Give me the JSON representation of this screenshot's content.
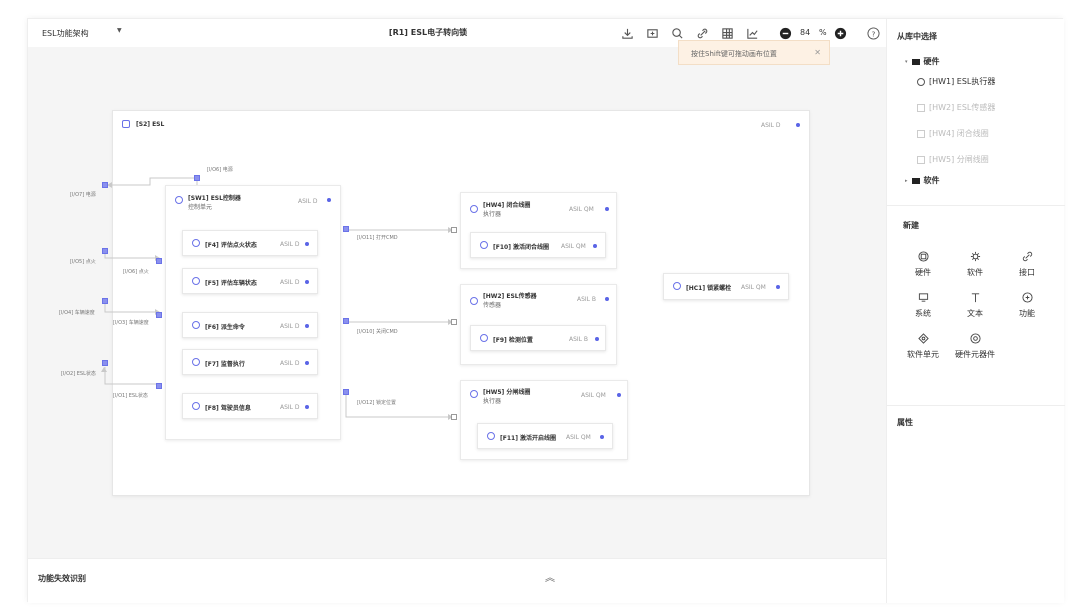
{
  "toolbar": {
    "architecture_select": "ESL功能架构",
    "title": "[R1] ESL电子转向锁",
    "zoom_value": "84",
    "zoom_unit": "%"
  },
  "toast": {
    "message": "按住Shift键可拖动画布位置"
  },
  "canvas": {
    "system": {
      "label": "[S2] ESL",
      "asil": "ASIL D"
    },
    "software": {
      "label": "[SW1] ESL控制器",
      "sub": "控制单元",
      "asil": "ASIL D"
    },
    "functions_left": [
      {
        "label": "[F4] 评估点火状态",
        "asil": "ASIL D"
      },
      {
        "label": "[F5] 评估车辆状态",
        "asil": "ASIL D"
      },
      {
        "label": "[F6] 派生命令",
        "asil": "ASIL D"
      },
      {
        "label": "[F7] 监督执行",
        "asil": "ASIL D"
      },
      {
        "label": "[F8] 驾驶员信息",
        "asil": "ASIL D"
      }
    ],
    "hw4": {
      "label": "[HW4] 闭合线圈",
      "sub": "执行器",
      "asil": "ASIL QM",
      "fn": "[F10] 激活闭合线圈",
      "fn_asil": "ASIL QM"
    },
    "hw2": {
      "label": "[HW2] ESL传感器",
      "sub": "传感器",
      "asil": "ASIL B",
      "fn": "[F9] 检测位置",
      "fn_asil": "ASIL B"
    },
    "hw5": {
      "label": "[HW5] 分闸线圈",
      "sub": "执行器",
      "asil": "ASIL QM",
      "fn": "[F11] 激活开启线圈",
      "fn_asil": "ASIL QM"
    },
    "hc1": {
      "label": "[HC1] 锁紧螺栓",
      "asil": "ASIL QM"
    },
    "signals": {
      "io7": "[I/O7] 电源",
      "io6_power": "[I/O6] 电源",
      "io5": "[I/O5] 点火",
      "io6_ign": "[I/O6] 点火",
      "io4": "[I/O4] 车辆速度",
      "io3": "[I/O3] 车辆速度",
      "io2": "[I/O2] ESL状态",
      "io1": "[I/O1] ESL状态",
      "io11": "[I/O11] 打开CMD",
      "io10": "[I/O10] 关闭CMD",
      "io12": "[I/O12] 锁定位置"
    }
  },
  "bottom": {
    "title": "功能失效识别"
  },
  "right_panel": {
    "library_title": "从库中选择",
    "hardware_group": "硬件",
    "hardware_items": [
      {
        "label": "[HW1] ESL执行器",
        "disabled": false
      },
      {
        "label": "[HW2] ESL传感器",
        "disabled": true
      },
      {
        "label": "[HW4] 闭合线圈",
        "disabled": true
      },
      {
        "label": "[HW5] 分闸线圈",
        "disabled": true
      }
    ],
    "software_group": "软件",
    "new_title": "新建",
    "new_items": [
      {
        "label": "硬件",
        "icon": "hardware-icon"
      },
      {
        "label": "软件",
        "icon": "software-icon"
      },
      {
        "label": "接口",
        "icon": "link-icon"
      },
      {
        "label": "系统",
        "icon": "system-icon"
      },
      {
        "label": "文本",
        "icon": "text-icon"
      },
      {
        "label": "功能",
        "icon": "function-icon"
      },
      {
        "label": "软件单元",
        "icon": "software-unit-icon"
      },
      {
        "label": "硬件元器件",
        "icon": "hardware-component-icon"
      }
    ],
    "props_title": "属性"
  },
  "colors": {
    "accent": "#5a64e6",
    "canvas": "#f5f5f5",
    "toast_bg": "#fdf1e4"
  }
}
